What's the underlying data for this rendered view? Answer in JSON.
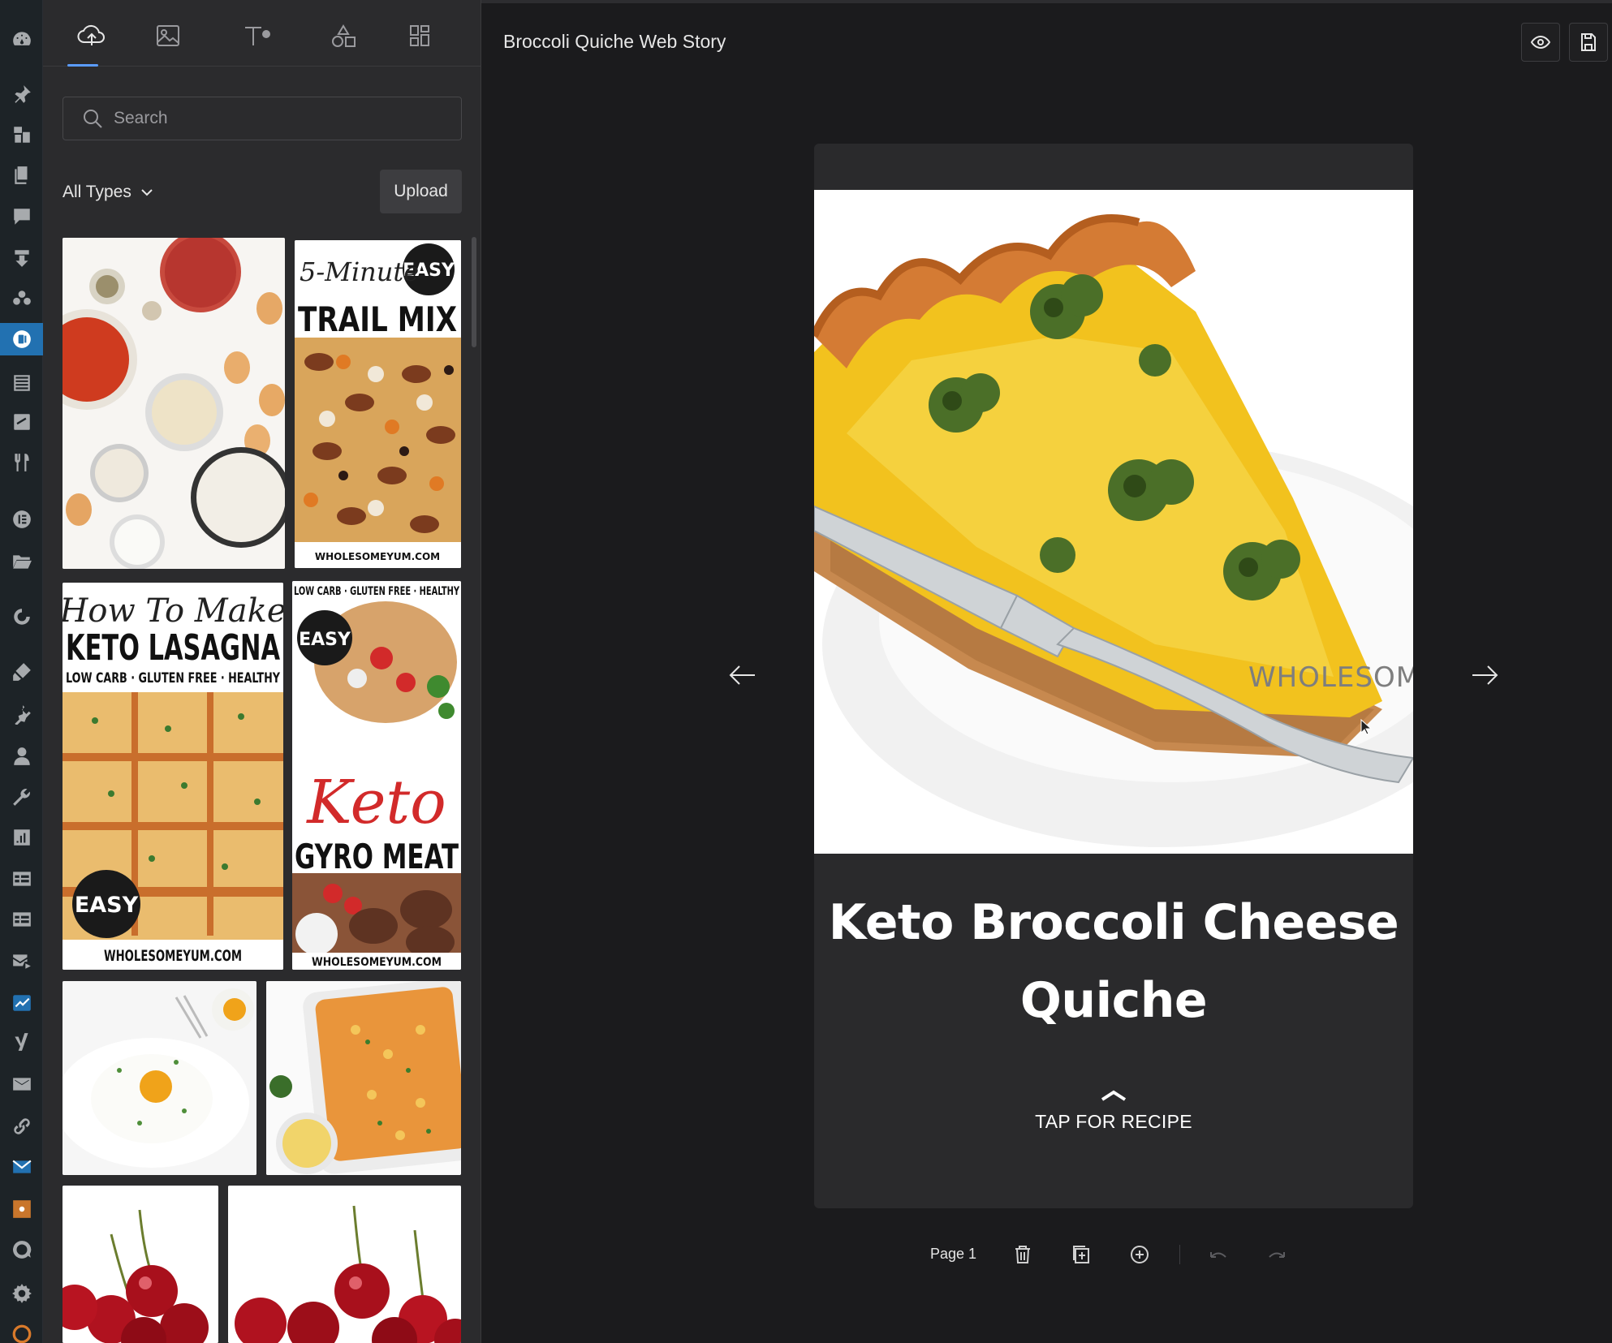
{
  "admin_rail": {
    "icons": [
      "dashboard-icon",
      "pin-icon",
      "media-icon",
      "pages-icon",
      "comments-icon",
      "download-icon",
      "users-group-icon",
      "web-stories-icon",
      "list-icon",
      "layout-icon",
      "recipe-icon",
      "elementor-icon",
      "folder-icon",
      "seo-icon",
      "appearance-icon",
      "plugins-icon",
      "user-icon",
      "tools-icon",
      "analytics-icon",
      "table-icon",
      "table-alt-icon",
      "mail-send-icon",
      "check-icon",
      "yoast-icon",
      "email-icon",
      "link-icon",
      "mail-icon",
      "sitemap-icon",
      "chat-icon",
      "settings-icon",
      "refresh-icon"
    ],
    "active": "web-stories-icon"
  },
  "library": {
    "tabs": [
      "upload-tab",
      "image-tab",
      "text-tab",
      "shapes-tab",
      "templates-tab"
    ],
    "active_tab": "upload-tab",
    "search": {
      "placeholder": "Search"
    },
    "filter_label": "All Types",
    "upload_label": "Upload",
    "thumbnails": [
      {
        "name": "thumb-pizza-ingredients"
      },
      {
        "name": "thumb-trail-mix",
        "badge": "EASY",
        "script": "5-Minute",
        "title": "TRAIL MIX",
        "credit": "WHOLESOMEYUM.COM"
      },
      {
        "name": "thumb-keto-lasagna",
        "script": "How To Make",
        "title": "KETO LASAGNA",
        "subtitle": "LOW CARB · GLUTEN FREE · HEALTHY",
        "badge": "EASY",
        "credit": "WHOLESOMEYUM.COM"
      },
      {
        "name": "thumb-keto-gyro",
        "subtitle": "LOW CARB · GLUTEN FREE · HEALTHY",
        "badge": "EASY",
        "script": "Keto",
        "title": "GYRO MEAT",
        "credit": "WHOLESOMEYUM.COM"
      },
      {
        "name": "thumb-cloud-eggs"
      },
      {
        "name": "thumb-casserole"
      },
      {
        "name": "thumb-cherries-1"
      },
      {
        "name": "thumb-cherries-2"
      }
    ]
  },
  "editor": {
    "story_title": "Broccoli Quiche Web Story",
    "preview_icon": "eye-icon",
    "save_icon": "save-icon",
    "page": {
      "headline": "Keto Broccoli Cheese Quiche",
      "cta": "TAP FOR RECIPE",
      "watermark": "WHOLESOME yum"
    },
    "page_label": "Page 1",
    "tools": [
      "delete-page-icon",
      "duplicate-page-icon",
      "add-page-icon",
      "undo-icon",
      "redo-icon"
    ]
  },
  "colors": {
    "accent": "#5b9cff",
    "admin_active": "#2271b1",
    "bg": "#1b1b1d",
    "panel": "#2b2b2d"
  }
}
